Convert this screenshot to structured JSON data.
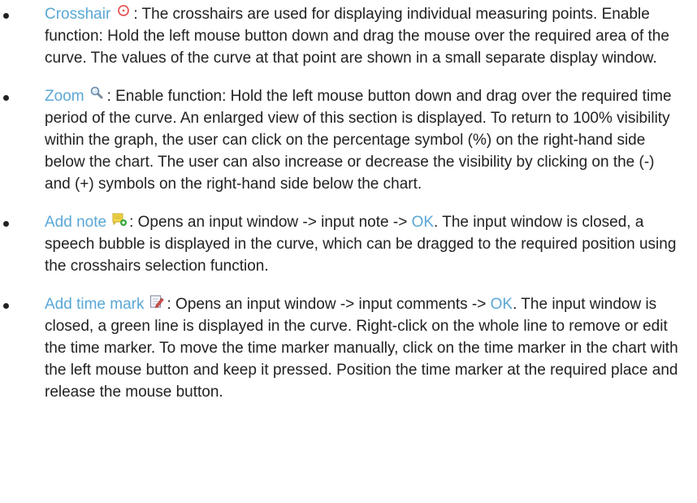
{
  "items": [
    {
      "term": "Crosshair",
      "icon": "crosshair-icon",
      "text": ": The crosshairs are used for displaying individual measuring points. Enable function: Hold the left mouse button down and drag the mouse over the required area of the curve. The values of the curve at that point are shown in a small separate display window."
    },
    {
      "term": "Zoom",
      "icon": "magnifier-icon",
      "text": ": Enable function: Hold the left mouse button down and drag over the required time period of the curve. An enlarged view of this section is displayed. To return to 100% visibility within the graph, the user can click on the percentage symbol (%) on the right-hand side below the chart. The user can also increase or decrease the visibility by clicking on the (-) and (+) symbols on the right-hand side below the chart."
    },
    {
      "term": "Add note",
      "icon": "add-note-icon",
      "text_before_ok": ": Opens an input window -> input note -> ",
      "ok": "OK",
      "text_after_ok": ". The input window is closed, a speech bubble is displayed in the curve, which can be dragged to the required position using the crosshairs selection function."
    },
    {
      "term": "Add time mark",
      "icon": "add-time-mark-icon",
      "text_before_ok": ": Opens an input window -> input comments -> ",
      "ok": "OK",
      "text_after_ok": ". The input window is closed, a green line is displayed in the curve. Right-click on the whole line to remove or edit the time marker. To move the time marker manually, click on the time marker in the chart with the left mouse button and keep it pressed. Position the time marker at the required place and release the mouse button."
    }
  ],
  "colors": {
    "term": "#5aa7d6",
    "text": "#222222",
    "crosshair_icon": "#e8585a",
    "note_icon": "#f2d64a",
    "note_plus": "#3aa83a"
  }
}
